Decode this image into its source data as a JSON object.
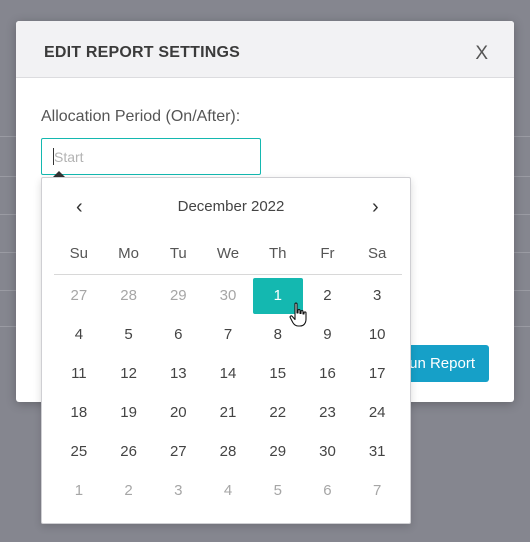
{
  "modal": {
    "title": "EDIT REPORT SETTINGS",
    "close_label": "X",
    "field_label": "Allocation Period (On/After):",
    "input_placeholder": "Start",
    "run_button_label": "un Report"
  },
  "datepicker": {
    "month_label": "December 2022",
    "prev_label": "‹",
    "next_label": "›",
    "weekdays": [
      "Su",
      "Mo",
      "Tu",
      "We",
      "Th",
      "Fr",
      "Sa"
    ],
    "selected_day": "1",
    "selected_color": "#14b8b0",
    "weeks": [
      [
        {
          "d": "27",
          "m": true
        },
        {
          "d": "28",
          "m": true
        },
        {
          "d": "29",
          "m": true
        },
        {
          "d": "30",
          "m": true
        },
        {
          "d": "1",
          "m": false,
          "sel": true
        },
        {
          "d": "2",
          "m": false
        },
        {
          "d": "3",
          "m": false
        }
      ],
      [
        {
          "d": "4",
          "m": false
        },
        {
          "d": "5",
          "m": false
        },
        {
          "d": "6",
          "m": false
        },
        {
          "d": "7",
          "m": false
        },
        {
          "d": "8",
          "m": false
        },
        {
          "d": "9",
          "m": false
        },
        {
          "d": "10",
          "m": false
        }
      ],
      [
        {
          "d": "11",
          "m": false
        },
        {
          "d": "12",
          "m": false
        },
        {
          "d": "13",
          "m": false
        },
        {
          "d": "14",
          "m": false
        },
        {
          "d": "15",
          "m": false
        },
        {
          "d": "16",
          "m": false
        },
        {
          "d": "17",
          "m": false
        }
      ],
      [
        {
          "d": "18",
          "m": false
        },
        {
          "d": "19",
          "m": false
        },
        {
          "d": "20",
          "m": false
        },
        {
          "d": "21",
          "m": false
        },
        {
          "d": "22",
          "m": false
        },
        {
          "d": "23",
          "m": false
        },
        {
          "d": "24",
          "m": false
        }
      ],
      [
        {
          "d": "25",
          "m": false
        },
        {
          "d": "26",
          "m": false
        },
        {
          "d": "27",
          "m": false
        },
        {
          "d": "28",
          "m": false
        },
        {
          "d": "29",
          "m": false
        },
        {
          "d": "30",
          "m": false
        },
        {
          "d": "31",
          "m": false
        }
      ],
      [
        {
          "d": "1",
          "m": true
        },
        {
          "d": "2",
          "m": true
        },
        {
          "d": "3",
          "m": true
        },
        {
          "d": "4",
          "m": true
        },
        {
          "d": "5",
          "m": true
        },
        {
          "d": "6",
          "m": true
        },
        {
          "d": "7",
          "m": true
        }
      ]
    ]
  },
  "icons": {
    "cursor": "hand-pointer-icon"
  }
}
